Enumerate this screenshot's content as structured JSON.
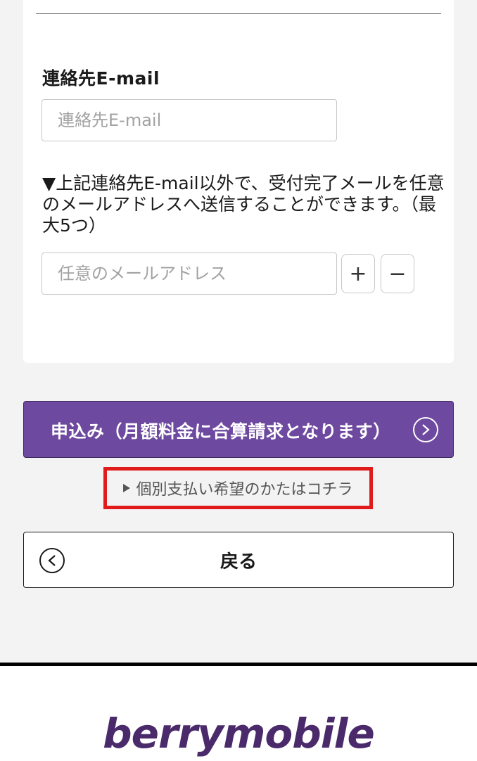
{
  "form": {
    "email_label": "連絡先E-mail",
    "email_placeholder": "連絡先E-mail",
    "extra_note": "▼上記連絡先E-mail以外で、受付完了メールを任意のメールアドレスへ送信することができます。（最大5つ）",
    "extra_placeholder": "任意のメールアドレス",
    "add_label": "+",
    "remove_label": "−"
  },
  "actions": {
    "apply_label": "申込み（月額料金に合算請求となります）",
    "separate_payment_link": "個別支払い希望のかたはコチラ",
    "back_label": "戻る"
  },
  "footer": {
    "logo_text": "berrymobile"
  },
  "colors": {
    "accent": "#6e49a0",
    "highlight_border": "#e11b1b",
    "logo": "#4a2a6b"
  },
  "icons": {
    "apply": "chevron-right-circle-icon",
    "back": "chevron-left-circle-icon",
    "link": "triangle-right-icon"
  }
}
